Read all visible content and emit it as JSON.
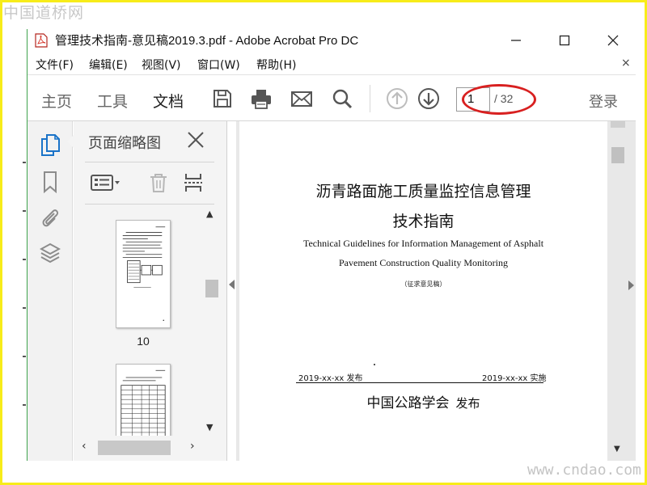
{
  "watermarks": {
    "top": "中国道桥网",
    "bottom": "www.cndao.com"
  },
  "window": {
    "title": "管理技术指南-意见稿2019.3.pdf - Adobe Acrobat Pro DC",
    "minimize_icon": "minimize-icon",
    "maximize_icon": "maximize-icon",
    "close_icon": "close-icon"
  },
  "menu": {
    "items": [
      "文件(F)",
      "编辑(E)",
      "视图(V)",
      "窗口(W)",
      "帮助(H)"
    ],
    "close_document": "×"
  },
  "toolbar": {
    "tabs": [
      "主页",
      "工具",
      "文档"
    ],
    "active_tab": "文档",
    "icons": [
      "save-icon",
      "print-icon",
      "email-icon",
      "search-icon",
      "page-up-icon",
      "page-down-icon"
    ],
    "current_page": "1",
    "total_pages": "/ 32",
    "login": "登录",
    "highlight_color": "#d82020"
  },
  "left_rail": {
    "icons": [
      "page-thumbnails-icon",
      "bookmark-icon",
      "attachment-icon",
      "layers-icon"
    ],
    "active_color": "#1a73c8"
  },
  "thumbnail_panel": {
    "title": "页面缩略图",
    "thumbnails": [
      {
        "label": "10"
      },
      {
        "label": ""
      }
    ]
  },
  "document": {
    "title_line1": "沥青路面施工质量监控信息管理",
    "title_line2": "技术指南",
    "english_line1": "Technical Guidelines for Information Management of Asphalt",
    "english_line2": "Pavement Construction Quality Monitoring",
    "draft_note": "（征求意见稿）",
    "issue_date": "2019-xx-xx 发布",
    "implement_date": "2019-xx-xx 实施",
    "organization": "中国公路学会",
    "publish_word": "发布"
  }
}
